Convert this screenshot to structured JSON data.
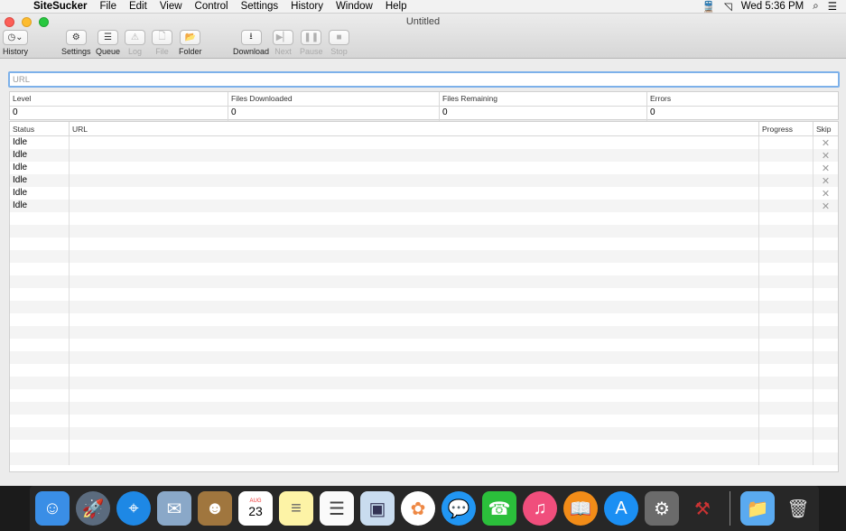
{
  "menubar": {
    "app": "SiteSucker",
    "items": [
      "File",
      "Edit",
      "View",
      "Control",
      "Settings",
      "History",
      "Window",
      "Help"
    ],
    "clock": "Wed 5:36 PM"
  },
  "window": {
    "title": "Untitled"
  },
  "toolbar": {
    "history": "History",
    "settings": "Settings",
    "queue": "Queue",
    "log": "Log",
    "file": "File",
    "folder": "Folder",
    "download": "Download",
    "next": "Next",
    "pause": "Pause",
    "stop": "Stop"
  },
  "url_field": {
    "placeholder": "URL"
  },
  "stats": {
    "headers": [
      "Level",
      "Files Downloaded",
      "Files Remaining",
      "Errors"
    ],
    "values": [
      "0",
      "0",
      "0",
      "0"
    ]
  },
  "table": {
    "columns": [
      "Status",
      "URL",
      "Progress",
      "Skip"
    ],
    "rows": [
      {
        "status": "Idle",
        "url": "",
        "progress": ""
      },
      {
        "status": "Idle",
        "url": "",
        "progress": ""
      },
      {
        "status": "Idle",
        "url": "",
        "progress": ""
      },
      {
        "status": "Idle",
        "url": "",
        "progress": ""
      },
      {
        "status": "Idle",
        "url": "",
        "progress": ""
      },
      {
        "status": "Idle",
        "url": "",
        "progress": ""
      }
    ]
  },
  "dock": {
    "calendar_month": "AUG",
    "calendar_day": "23"
  },
  "colors": {
    "accent": "#7db1ea"
  }
}
